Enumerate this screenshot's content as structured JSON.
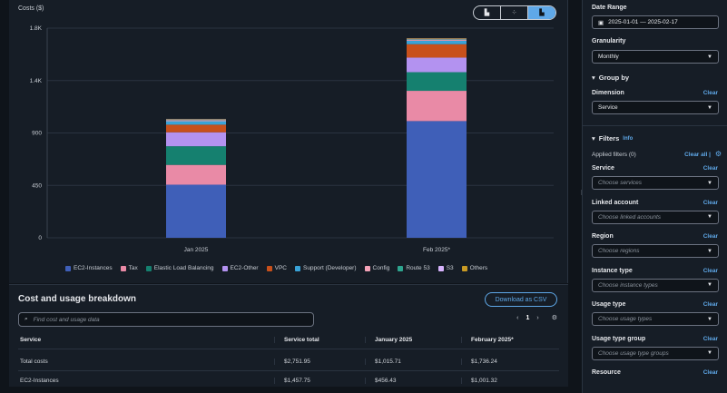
{
  "chart": {
    "y_axis_title": "Costs ($)",
    "view_options": [
      "bar-chart-icon",
      "scatter-chart-icon",
      "stacked-bar-icon"
    ],
    "active_view": 2
  },
  "chart_data": {
    "type": "bar",
    "stacked": true,
    "ylabel": "Costs ($)",
    "ylim": [
      0,
      1800
    ],
    "y_ticks": [
      "0",
      "450",
      "900",
      "1.4K",
      "1.8K"
    ],
    "categories": [
      "Jan 2025",
      "Feb 2025*"
    ],
    "series": [
      {
        "name": "EC2-Instances",
        "color": "#3f5fb8",
        "values": [
          456,
          1002
        ]
      },
      {
        "name": "Tax",
        "color": "#e98aa6",
        "values": [
          170,
          260
        ]
      },
      {
        "name": "Elastic Load Balancing",
        "color": "#15806f",
        "values": [
          160,
          160
        ]
      },
      {
        "name": "EC2-Other",
        "color": "#b392f0",
        "values": [
          120,
          125
        ]
      },
      {
        "name": "VPC",
        "color": "#c8501b",
        "values": [
          65,
          115
        ]
      },
      {
        "name": "Support (Developer)",
        "color": "#39a3d8",
        "values": [
          30,
          30
        ]
      },
      {
        "name": "Config",
        "color": "#f4a3b8",
        "values": [
          10,
          10
        ]
      },
      {
        "name": "Route 53",
        "color": "#2ea58f",
        "values": [
          4,
          4
        ]
      },
      {
        "name": "S3",
        "color": "#d8b4fe",
        "values": [
          3,
          3
        ]
      },
      {
        "name": "Others",
        "color": "#c99a24",
        "values": [
          3,
          4
        ]
      }
    ],
    "grid": true,
    "legend_position": "bottom"
  },
  "breakdown": {
    "title": "Cost and usage breakdown",
    "download_label": "Download as CSV",
    "search_placeholder": "Find cost and usage data",
    "page": "1",
    "columns": [
      "Service",
      "Service total",
      "January 2025",
      "February 2025*"
    ],
    "rows": [
      [
        "Total costs",
        "$2,751.95",
        "$1,015.71",
        "$1,736.24"
      ],
      [
        "EC2-Instances",
        "$1,457.75",
        "$456.43",
        "$1,001.32"
      ]
    ]
  },
  "sidebar": {
    "date_range_label": "Date Range",
    "date_range_value": "2025-01-01 — 2025-02-17",
    "granularity_label": "Granularity",
    "granularity_value": "Monthly",
    "group_by_title": "Group by",
    "dimension_label": "Dimension",
    "dimension_value": "Service",
    "clear": "Clear",
    "filters_title": "Filters",
    "filters_info": "Info",
    "applied_filters": "Applied filters (0)",
    "clear_all": "Clear all |",
    "filters": [
      {
        "label": "Service",
        "placeholder": "Choose services"
      },
      {
        "label": "Linked account",
        "placeholder": "Choose linked accounts"
      },
      {
        "label": "Region",
        "placeholder": "Choose regions"
      },
      {
        "label": "Instance type",
        "placeholder": "Choose instance types"
      },
      {
        "label": "Usage type",
        "placeholder": "Choose usage types"
      },
      {
        "label": "Usage type group",
        "placeholder": "Choose usage type groups"
      },
      {
        "label": "Resource",
        "placeholder": ""
      }
    ]
  }
}
